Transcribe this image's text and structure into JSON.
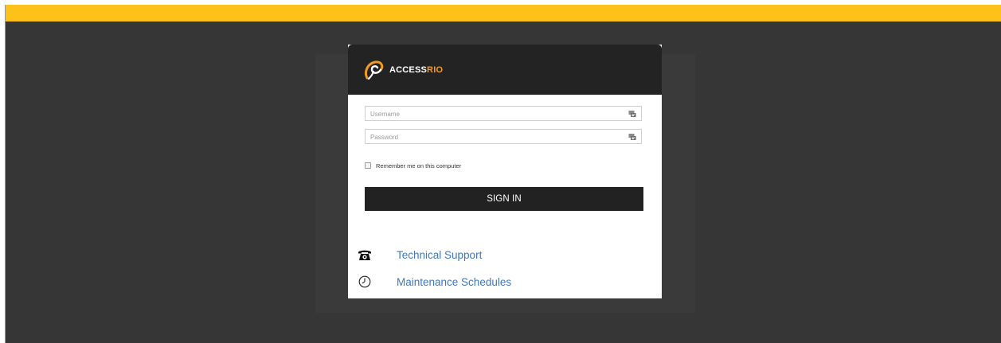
{
  "brand": {
    "logo_text_main": "ACCESS",
    "logo_text_accent": "RIO",
    "accent_color": "#f39a1e",
    "top_bar_color": "#fdc21a"
  },
  "login": {
    "username_placeholder": "Username",
    "password_placeholder": "Password",
    "remember_label": "Remember me on this computer",
    "sign_in_label": "SIGN IN"
  },
  "links": [
    {
      "icon": "telephone-icon",
      "label": "Technical Support"
    },
    {
      "icon": "clock-icon",
      "label": "Maintenance Schedules"
    }
  ]
}
